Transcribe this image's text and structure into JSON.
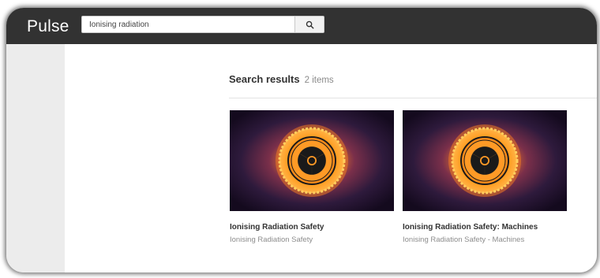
{
  "header": {
    "logo": "Pulse",
    "search": {
      "value": "Ionising radiation",
      "placeholder": ""
    },
    "search_button_icon": "search-icon"
  },
  "results": {
    "title": "Search results",
    "count": "2 items",
    "items": [
      {
        "title": "Ionising Radiation Safety",
        "subtitle": "Ionising Radiation Safety",
        "thumbnail_icon": "radiation-icon"
      },
      {
        "title": "Ionising Radiation Safety: Machines",
        "subtitle": "Ionising Radiation Safety - Machines",
        "thumbnail_icon": "radiation-icon"
      }
    ]
  },
  "colors": {
    "topbar": "#323232",
    "sidebar": "#ececec",
    "thumb_center": "#ff8a1c",
    "thumb_background": "#1c0f2a"
  }
}
